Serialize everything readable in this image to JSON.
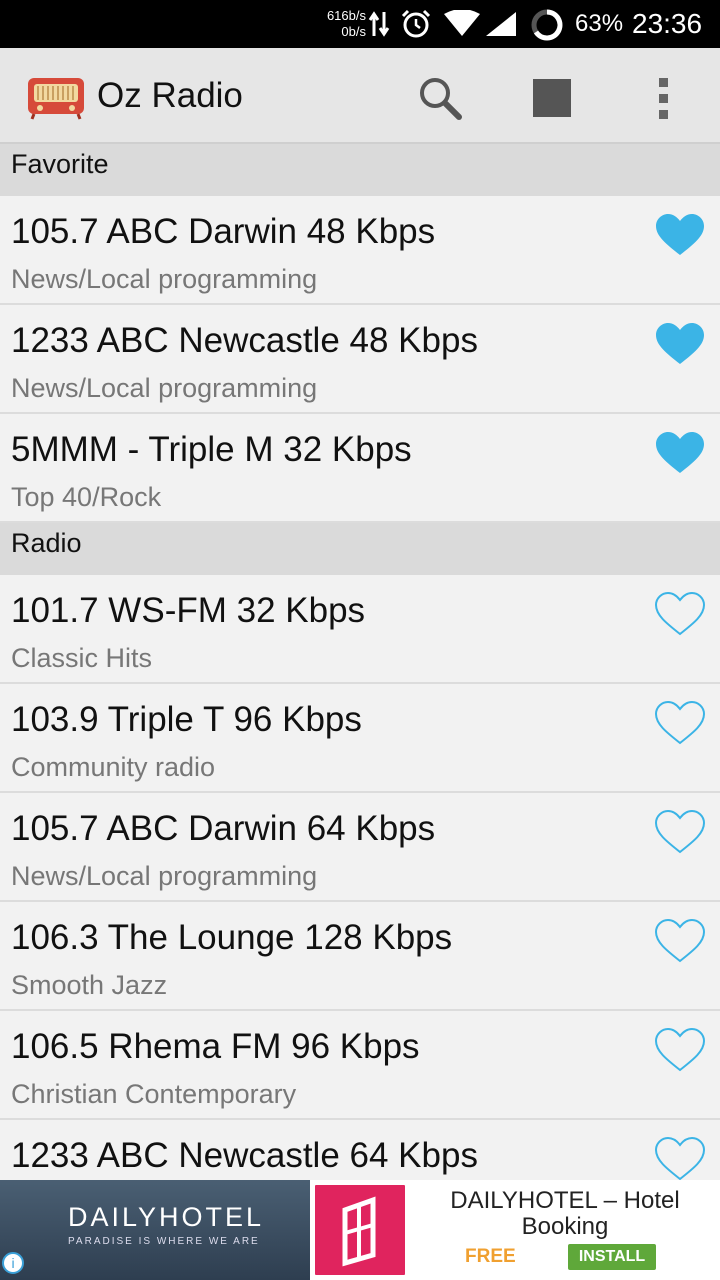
{
  "status_bar": {
    "net_up": "616b/s",
    "net_down": "0b/s",
    "battery": "63%",
    "time": "23:36"
  },
  "app_bar": {
    "title": "Oz Radio",
    "icons": [
      "radio-logo-icon",
      "search-icon",
      "stop-icon",
      "overflow-menu-icon"
    ]
  },
  "sections": {
    "favorite": {
      "label": "Favorite",
      "items": [
        {
          "title": "105.7 ABC Darwin 48 Kbps",
          "subtitle": "News/Local programming",
          "favorite": true
        },
        {
          "title": "1233 ABC Newcastle 48 Kbps",
          "subtitle": "News/Local programming",
          "favorite": true
        },
        {
          "title": "5MMM - Triple M 32 Kbps",
          "subtitle": "Top 40/Rock",
          "favorite": true
        }
      ]
    },
    "radio": {
      "label": "Radio",
      "items": [
        {
          "title": "101.7 WS-FM 32 Kbps",
          "subtitle": "Classic Hits",
          "favorite": false
        },
        {
          "title": "103.9 Triple T 96 Kbps",
          "subtitle": "Community radio",
          "favorite": false
        },
        {
          "title": "105.7 ABC Darwin 64 Kbps",
          "subtitle": "News/Local programming",
          "favorite": false
        },
        {
          "title": "106.3 The Lounge 128 Kbps",
          "subtitle": "Smooth Jazz",
          "favorite": false
        },
        {
          "title": "106.5 Rhema FM 96 Kbps",
          "subtitle": "Christian Contemporary",
          "favorite": false
        },
        {
          "title": "1233 ABC Newcastle 64 Kbps",
          "subtitle": "",
          "favorite": false
        }
      ]
    }
  },
  "ad": {
    "brand": "DAILYHOTEL",
    "tagline": "PARADISE IS WHERE WE ARE",
    "title_line1": "DAILYHOTEL – Hotel",
    "title_line2": "Booking",
    "price": "FREE",
    "install_label": "INSTALL"
  },
  "colors": {
    "heart": "#3bb4e6",
    "section_header": "#dadada",
    "app_bar": "#e6e6e6",
    "install_button": "#5fa83a",
    "free_text": "#f0a030"
  }
}
